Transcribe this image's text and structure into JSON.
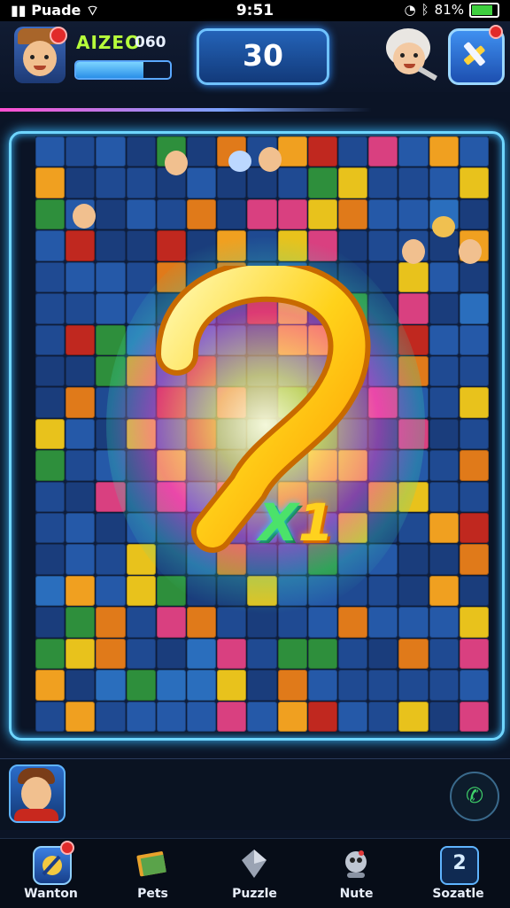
{
  "status": {
    "carrier": "Puade",
    "time": "9:51",
    "battery": "81%"
  },
  "header": {
    "player_name": "AIZEO",
    "player_score": "060",
    "xp_progress": 0.72,
    "main_score": "30"
  },
  "board": {
    "columns": 15,
    "rows": 19,
    "multiplier_prefix": "X",
    "multiplier_value": "1",
    "colors": [
      "#1f4a92",
      "#2559a8",
      "#1a3d7c",
      "#e07a1a",
      "#f0a020",
      "#2e8f3c",
      "#c0281f",
      "#e8c21c",
      "#2a6ebd",
      "#d94080"
    ]
  },
  "nav": {
    "items": [
      {
        "label": "Wanton",
        "icon": "home-pin-icon",
        "active": true
      },
      {
        "label": "Pets",
        "icon": "book-icon",
        "active": false
      },
      {
        "label": "Puzzle",
        "icon": "gem-icon",
        "active": false
      },
      {
        "label": "Nute",
        "icon": "robot-icon",
        "active": false
      },
      {
        "label": "Sozatle",
        "icon": "level-2-icon",
        "active": false
      }
    ],
    "level_number": "2"
  }
}
